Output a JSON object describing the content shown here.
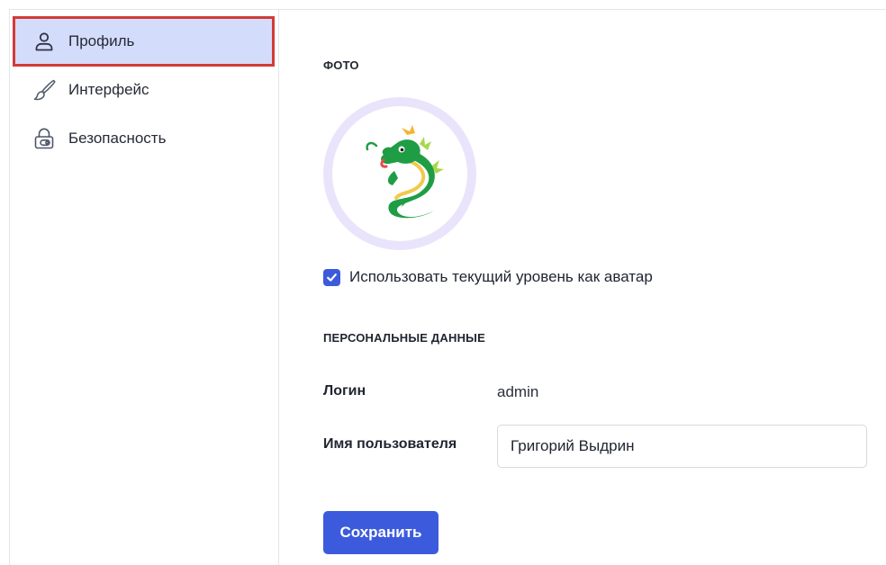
{
  "sidebar": {
    "items": [
      {
        "label": "Профиль",
        "icon": "user-icon",
        "active": true
      },
      {
        "label": "Интерфейс",
        "icon": "brush-icon",
        "active": false
      },
      {
        "label": "Безопасность",
        "icon": "lock-icon",
        "active": false
      }
    ]
  },
  "photo": {
    "section_title": "ФОТО",
    "avatar_icon": "dragon-icon",
    "use_level_checkbox": {
      "label": "Использовать текущий уровень как аватар",
      "checked": true
    }
  },
  "personal": {
    "section_title": "ПЕРСОНАЛЬНЫЕ ДАННЫЕ",
    "login_label": "Логин",
    "login_value": "admin",
    "username_label": "Имя пользователя",
    "username_value": "Григорий Выдрин"
  },
  "actions": {
    "save_label": "Сохранить"
  },
  "colors": {
    "accent": "#3c5bdc",
    "active_nav_bg": "#d4dcfb",
    "highlight_border": "#d23b36",
    "avatar_ring": "#e9e4fb"
  }
}
